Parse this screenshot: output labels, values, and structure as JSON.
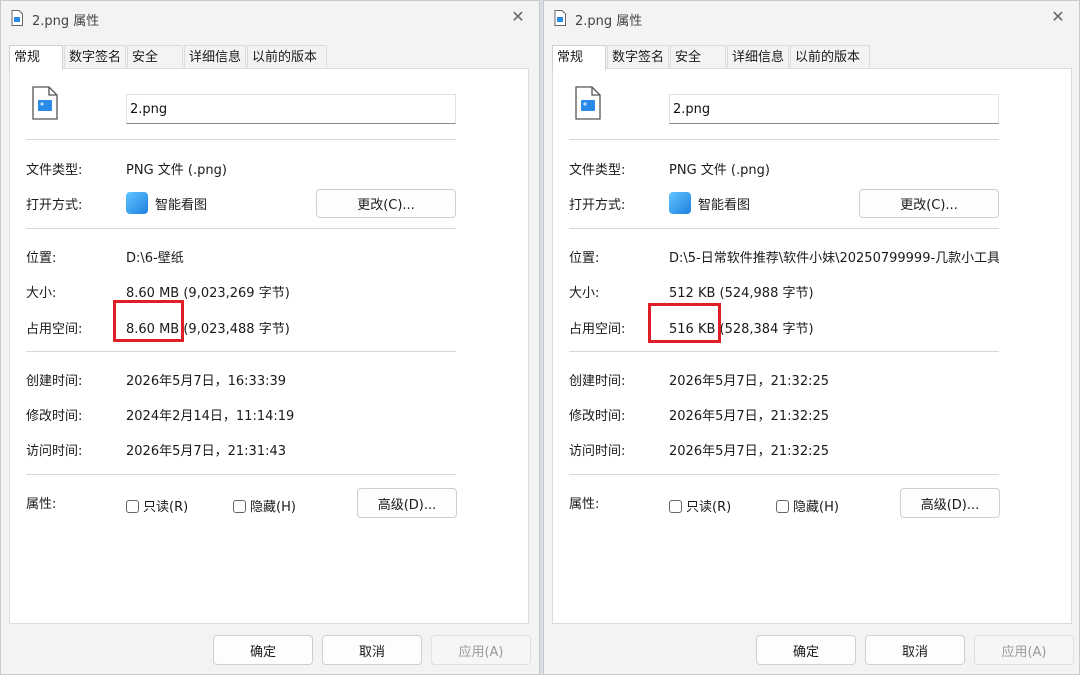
{
  "left": {
    "title": "2.png 属性",
    "tabs": [
      "常规",
      "数字签名",
      "安全",
      "详细信息",
      "以前的版本"
    ],
    "filename": "2.png",
    "labels": {
      "type": "文件类型:",
      "open_with": "打开方式:",
      "location": "位置:",
      "size": "大小:",
      "size_on_disk": "占用空间:",
      "created": "创建时间:",
      "modified": "修改时间:",
      "accessed": "访问时间:",
      "attributes": "属性:"
    },
    "type_value": "PNG 文件 (.png)",
    "open_with_app": "智能看图",
    "change_button": "更改(C)...",
    "location_value": "D:\\6-壁纸",
    "size_value": "8.60 MB (9,023,269 字节)",
    "size_on_disk_value": "8.60 MB (9,023,488 字节)",
    "created_value": "2026年5月7日，16:33:39",
    "modified_value": "2024年2月14日，11:14:19",
    "accessed_value": "2026年5月7日，21:31:43",
    "readonly_label": "只读(R)",
    "hidden_label": "隐藏(H)",
    "advanced_button": "高级(D)...",
    "ok_button": "确定",
    "cancel_button": "取消",
    "apply_button": "应用(A)"
  },
  "right": {
    "title": "2.png 属性",
    "tabs": [
      "常规",
      "数字签名",
      "安全",
      "详细信息",
      "以前的版本"
    ],
    "filename": "2.png",
    "labels": {
      "type": "文件类型:",
      "open_with": "打开方式:",
      "location": "位置:",
      "size": "大小:",
      "size_on_disk": "占用空间:",
      "created": "创建时间:",
      "modified": "修改时间:",
      "accessed": "访问时间:",
      "attributes": "属性:"
    },
    "type_value": "PNG 文件 (.png)",
    "open_with_app": "智能看图",
    "change_button": "更改(C)...",
    "location_value": "D:\\5-日常软件推荐\\软件小妹\\20250799999-几款小工具",
    "size_value": "512 KB (524,988 字节)",
    "size_on_disk_value": "516 KB (528,384 字节)",
    "created_value": "2026年5月7日，21:32:25",
    "modified_value": "2026年5月7日，21:32:25",
    "accessed_value": "2026年5月7日，21:32:25",
    "readonly_label": "只读(R)",
    "hidden_label": "隐藏(H)",
    "advanced_button": "高级(D)...",
    "ok_button": "确定",
    "cancel_button": "取消",
    "apply_button": "应用(A)"
  },
  "colors": {
    "highlight": "#e01e28",
    "app_icon": "#1e7fe0"
  },
  "icons": {
    "title_icon": "png-file-icon",
    "big_icon": "png-file-icon",
    "app_icon": "image-viewer-app-icon",
    "close_icon": "close-icon"
  }
}
